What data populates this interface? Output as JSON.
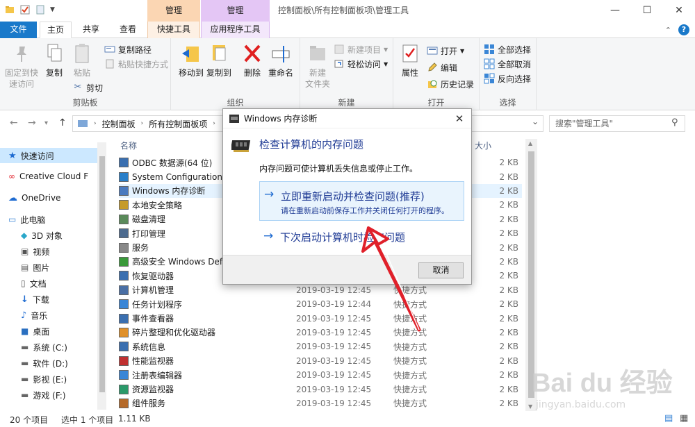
{
  "window": {
    "path_title": "控制面板\\所有控制面板项\\管理工具",
    "context_tab_a": "管理",
    "context_tab_b": "管理",
    "minimize": "—",
    "maximize": "☐",
    "close": "✕"
  },
  "tabs": {
    "file": "文件",
    "home": "主页",
    "share": "共享",
    "view": "查看",
    "shortcut_tools": "快捷工具",
    "app_tools": "应用程序工具"
  },
  "ribbon": {
    "clipboard": {
      "label": "剪贴板",
      "pin": "固定到快\n速访问",
      "copy": "复制",
      "paste": "粘贴",
      "copy_path": "复制路径",
      "paste_shortcut": "粘贴快捷方式",
      "cut": "剪切"
    },
    "organize": {
      "label": "组织",
      "move_to": "移动到",
      "copy_to": "复制到",
      "delete": "删除",
      "rename": "重命名"
    },
    "new": {
      "label": "新建",
      "new_folder": "新建\n文件夹",
      "new_item": "新建项目",
      "easy_access": "轻松访问"
    },
    "open": {
      "label": "打开",
      "properties": "属性",
      "open": "打开",
      "edit": "编辑",
      "history": "历史记录"
    },
    "select": {
      "label": "选择",
      "select_all": "全部选择",
      "select_none": "全部取消",
      "invert": "反向选择"
    }
  },
  "address": {
    "crumbs": [
      "控制面板",
      "所有控制面板项"
    ],
    "search_placeholder": "搜索\"管理工具\""
  },
  "nav": {
    "items": [
      "快速访问",
      "Creative Cloud F",
      "OneDrive",
      "此电脑",
      "3D 对象",
      "视频",
      "图片",
      "文档",
      "下载",
      "音乐",
      "桌面",
      "系统 (C:)",
      "软件 (D:)",
      "影视 (E:)",
      "游戏 (F:)"
    ]
  },
  "filelist": {
    "col_name": "名称",
    "col_size": "大小",
    "rows": [
      {
        "name": "ODBC 数据源(64 位)",
        "date": "",
        "type": "",
        "size": "2 KB"
      },
      {
        "name": "System Configuration",
        "date": "",
        "type": "",
        "size": "2 KB"
      },
      {
        "name": "Windows 内存诊断",
        "date": "",
        "type": "",
        "size": "2 KB"
      },
      {
        "name": "本地安全策略",
        "date": "",
        "type": "",
        "size": "2 KB"
      },
      {
        "name": "磁盘清理",
        "date": "",
        "type": "",
        "size": "2 KB"
      },
      {
        "name": "打印管理",
        "date": "",
        "type": "",
        "size": "2 KB"
      },
      {
        "name": "服务",
        "date": "",
        "type": "",
        "size": "2 KB"
      },
      {
        "name": "高级安全 Windows Defe",
        "date": "",
        "type": "",
        "size": "2 KB"
      },
      {
        "name": "恢复驱动器",
        "date": "",
        "type": "",
        "size": "2 KB"
      },
      {
        "name": "计算机管理",
        "date": "2019-03-19 12:45",
        "type": "快捷方式",
        "size": "2 KB"
      },
      {
        "name": "任务计划程序",
        "date": "2019-03-19 12:44",
        "type": "快捷方式",
        "size": "2 KB"
      },
      {
        "name": "事件查看器",
        "date": "2019-03-19 12:45",
        "type": "快捷方式",
        "size": "2 KB"
      },
      {
        "name": "碎片整理和优化驱动器",
        "date": "2019-03-19 12:45",
        "type": "快捷方式",
        "size": "2 KB"
      },
      {
        "name": "系统信息",
        "date": "2019-03-19 12:45",
        "type": "快捷方式",
        "size": "2 KB"
      },
      {
        "name": "性能监视器",
        "date": "2019-03-19 12:45",
        "type": "快捷方式",
        "size": "2 KB"
      },
      {
        "name": "注册表编辑器",
        "date": "2019-03-19 12:45",
        "type": "快捷方式",
        "size": "2 KB"
      },
      {
        "name": "资源监视器",
        "date": "2019-03-19 12:45",
        "type": "快捷方式",
        "size": "2 KB"
      },
      {
        "name": "组件服务",
        "date": "2019-03-19 12:45",
        "type": "快捷方式",
        "size": "2 KB"
      }
    ]
  },
  "status": {
    "count": "20 个项目",
    "selected": "选中 1 个项目",
    "size": "1.11 KB"
  },
  "dialog": {
    "title": "Windows 内存诊断",
    "heading": "检查计算机的内存问题",
    "message": "内存问题可使计算机丢失信息或停止工作。",
    "option1_title": "立即重新启动并检查问题(推荐)",
    "option1_sub": "请在重新启动前保存工作并关闭任何打开的程序。",
    "option2_title": "下次启动计算机时检查问题",
    "cancel": "取消",
    "arrow": "→"
  },
  "watermark": {
    "brand": "Bai du 经验",
    "url": "jingyan.baidu.com"
  },
  "colors": {
    "accent": "#1979ca",
    "link": "#1e3a94",
    "annotation": "#e0202a"
  }
}
